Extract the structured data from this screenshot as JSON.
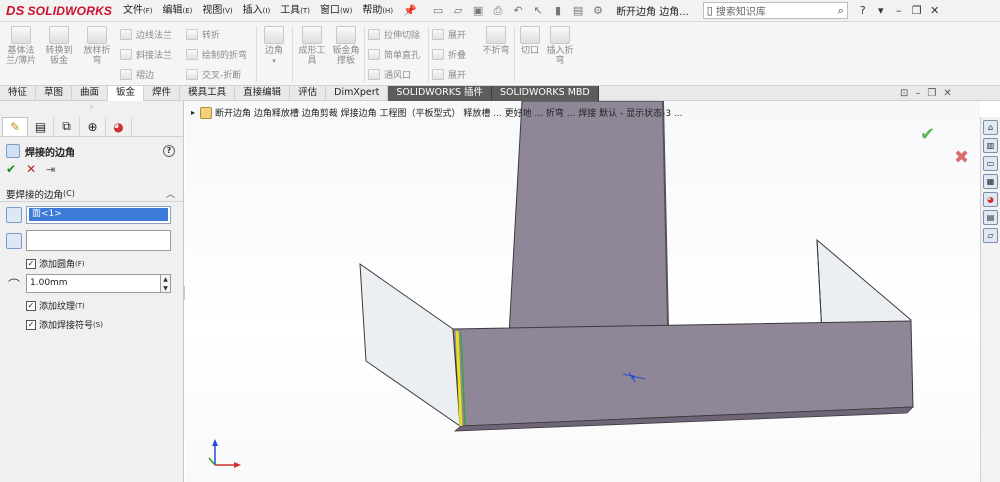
{
  "app": {
    "logo_text": "SOLIDWORKS",
    "logo_mark": "DS",
    "menu": [
      {
        "label": "文件",
        "acc": "(F)"
      },
      {
        "label": "编辑",
        "acc": "(E)"
      },
      {
        "label": "视图",
        "acc": "(V)"
      },
      {
        "label": "插入",
        "acc": "(I)"
      },
      {
        "label": "工具",
        "acc": "(T)"
      },
      {
        "label": "窗口",
        "acc": "(W)"
      },
      {
        "label": "帮助",
        "acc": "(H)"
      }
    ],
    "doc_title": "断开边角 边角...",
    "search_placeholder": "搜索知识库",
    "help_glyph": "?"
  },
  "ribbon": {
    "tools": [
      {
        "label": "基体法\n兰/薄片"
      },
      {
        "label": "转换到\n钣金"
      },
      {
        "label": "放样折\n弯"
      },
      {
        "label": "边角"
      },
      {
        "label": "成形工\n具"
      },
      {
        "label": "钣金角\n撑板"
      },
      {
        "label": "不折弯"
      },
      {
        "label": "切口"
      },
      {
        "label": "插入折\n弯"
      }
    ],
    "small_tools": [
      {
        "label": "边线法兰"
      },
      {
        "label": "斜接法兰"
      },
      {
        "label": "褶边"
      },
      {
        "label": "转折"
      },
      {
        "label": "绘制的折弯"
      },
      {
        "label": "交叉-折断"
      },
      {
        "label": "拉伸切除"
      },
      {
        "label": "简单直孔"
      },
      {
        "label": "通风口"
      },
      {
        "label": "展开"
      },
      {
        "label": "折叠"
      },
      {
        "label": "展开"
      }
    ]
  },
  "tabs": [
    {
      "label": "特征"
    },
    {
      "label": "草图"
    },
    {
      "label": "曲面"
    },
    {
      "label": "钣金"
    },
    {
      "label": "焊件"
    },
    {
      "label": "模具工具"
    },
    {
      "label": "直接编辑"
    },
    {
      "label": "评估"
    },
    {
      "label": "DimXpert"
    },
    {
      "label": "SOLIDWORKS 插件"
    },
    {
      "label": "SOLIDWORKS MBD"
    }
  ],
  "property_manager": {
    "title": "焊接的边角",
    "group_title": "要焊接的边角",
    "group_acc": "(C)",
    "selection": "面<1>",
    "fillet_label": "添加圆角",
    "fillet_acc": "(F)",
    "fillet_radius": "1.00mm",
    "texture_label": "添加纹理",
    "texture_acc": "(T)",
    "weld_symbol_label": "添加焊接符号",
    "weld_symbol_acc": "(S)",
    "check_glyph": "✓"
  },
  "viewport": {
    "breadcrumb": "断开边角 边角释放槽 边角剪裁 焊接边角 工程图（平板型式） 释放槽 ... 更好地 ... 折弯 ... 焊接  默认 - 显示状态-3 ..."
  },
  "colors": {
    "sheet_gray": "#8f8797",
    "sheet_dark": "#6e6677",
    "flange_light": "#eceff2",
    "weld_yellow": "#e8e020",
    "weld_green": "#3aa04a",
    "brand_red": "#c8102e"
  }
}
